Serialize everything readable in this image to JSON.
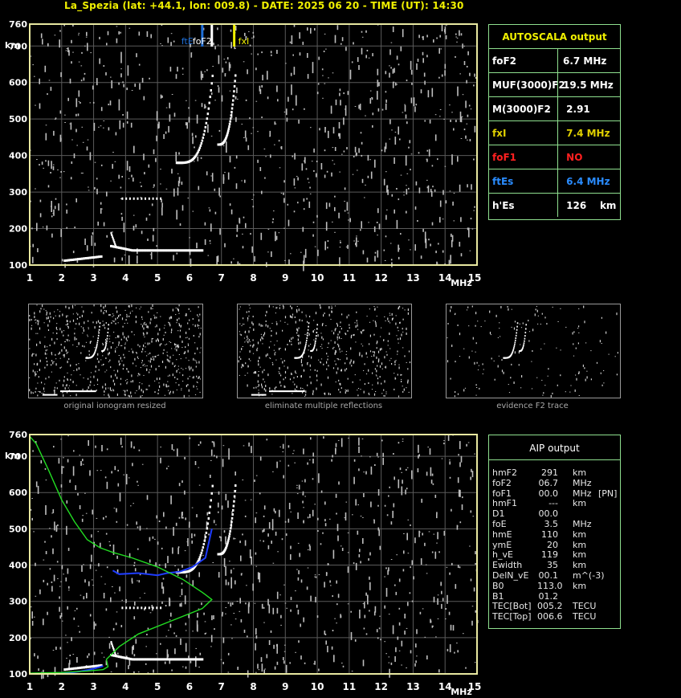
{
  "header": {
    "title": "La_Spezia (lat: +44.1, lon: 009.8) - DATE: 2025 06 20 - TIME (UT): 14:30"
  },
  "ionogram": {
    "y_unit": "km",
    "x_unit": "MHz",
    "y_ticks": [
      "760",
      "700",
      "600",
      "500",
      "400",
      "300",
      "200",
      "100"
    ],
    "x_ticks": [
      "1",
      "2",
      "3",
      "4",
      "5",
      "6",
      "7",
      "8",
      "9",
      "10",
      "11",
      "12",
      "13",
      "14",
      "15"
    ],
    "markers": {
      "ftE_label": "ftE",
      "foF2_label": "foF2",
      "fxl_label": "fxI",
      "ftE_color": "#1e6fd9",
      "foF2_color": "#ffffff",
      "fxl_color": "#f0f000"
    }
  },
  "autoscala": {
    "title": "AUTOSCALA output",
    "rows": [
      {
        "key": "foF2",
        "value": "6.7 MHz",
        "key_color": "#ffffff",
        "value_color": "#ffffff"
      },
      {
        "key": "MUF(3000)F2",
        "value": "19.5 MHz",
        "key_color": "#ffffff",
        "value_color": "#ffffff"
      },
      {
        "key": "M(3000)F2",
        "value": " 2.91",
        "key_color": "#ffffff",
        "value_color": "#ffffff"
      },
      {
        "key": "fxI",
        "value": " 7.4 MHz",
        "key_color": "#e0d000",
        "value_color": "#e0d000"
      },
      {
        "key": "foF1",
        "value": " NO",
        "key_color": "#ff2020",
        "value_color": "#ff2020"
      },
      {
        "key": "ftEs",
        "value": " 6.4 MHz",
        "key_color": "#2a8cff",
        "value_color": "#2a8cff"
      },
      {
        "key": "h'Es",
        "value": " 126    km",
        "key_color": "#ffffff",
        "value_color": "#ffffff"
      }
    ]
  },
  "thumbnails": [
    {
      "caption": "original ionogram resized"
    },
    {
      "caption": "eliminate multiple reflections"
    },
    {
      "caption": "evidence F2 trace"
    }
  ],
  "aip": {
    "title": "AIP output",
    "rows": [
      {
        "k": "hmF2",
        "v": "291",
        "u": "km",
        "x": ""
      },
      {
        "k": "foF2",
        "v": "06.7",
        "u": "MHz",
        "x": ""
      },
      {
        "k": "foF1",
        "v": "00.0",
        "u": "MHz",
        "x": "[PN]"
      },
      {
        "k": "hmF1",
        "v": "---",
        "u": "km",
        "x": ""
      },
      {
        "k": "D1",
        "v": "00.0",
        "u": "",
        "x": ""
      },
      {
        "k": "foE",
        "v": "3.5",
        "u": "MHz",
        "x": ""
      },
      {
        "k": "hmE",
        "v": "110",
        "u": "km",
        "x": ""
      },
      {
        "k": "ymE",
        "v": "20",
        "u": "km",
        "x": ""
      },
      {
        "k": "h_vE",
        "v": "119",
        "u": "km",
        "x": ""
      },
      {
        "k": "Ewidth",
        "v": "35",
        "u": "km",
        "x": ""
      },
      {
        "k": "DelN_vE",
        "v": "00.1",
        "u": "m^(-3)",
        "x": ""
      },
      {
        "k": "B0",
        "v": "113.0",
        "u": "km",
        "x": ""
      },
      {
        "k": "B1",
        "v": "01.2",
        "u": "",
        "x": ""
      },
      {
        "k": "TEC[Bot]",
        "v": "005.2",
        "u": "TECU",
        "x": ""
      },
      {
        "k": "TEC[Top]",
        "v": "006.6",
        "u": "TECU",
        "x": ""
      }
    ]
  },
  "colors": {
    "frame": "#e8e8a0",
    "grid": "#5a5a5a",
    "trace": "#ffffff",
    "profile": "#22dd22",
    "true_height": "#1e3cff",
    "panel_border": "#8fe08f"
  }
}
